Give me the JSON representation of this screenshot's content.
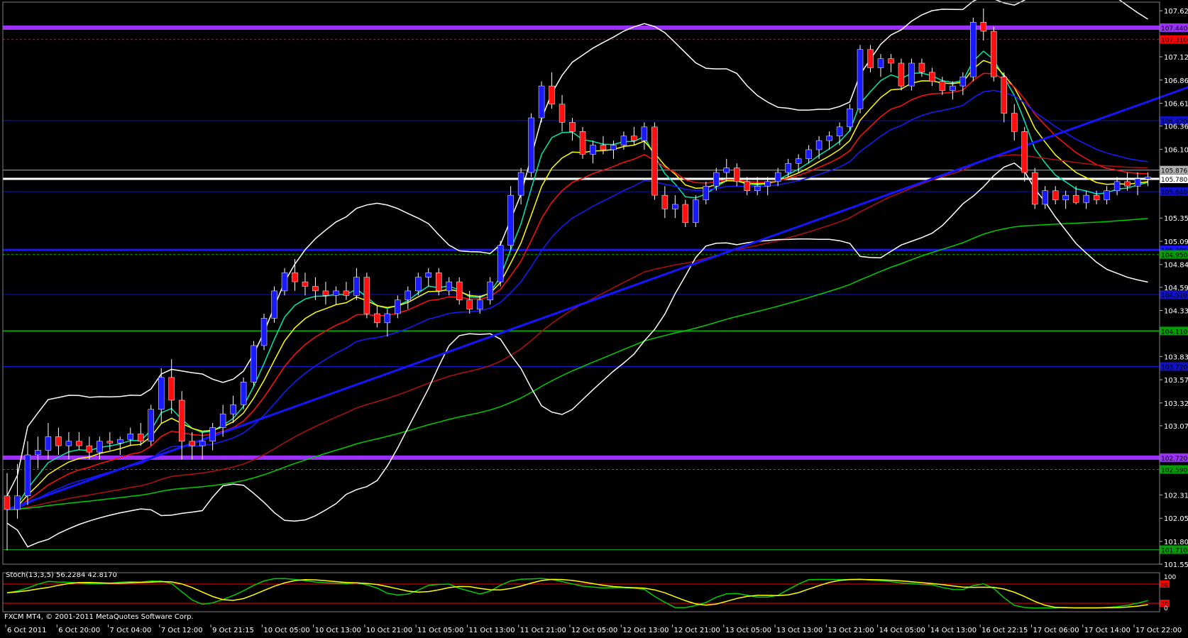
{
  "chart_data": {
    "type": "candlestick",
    "instrument_info": "",
    "footer": "FXCM MT4, © 2001-2011 MetaQuotes Software Corp.",
    "price_axis": {
      "ylim": [
        101.55,
        107.72
      ],
      "ticks": [
        "107.625",
        "107.120",
        "106.865",
        "106.610",
        "106.360",
        "106.105",
        "105.350",
        "105.095",
        "104.840",
        "104.590",
        "104.335",
        "103.830",
        "103.575",
        "103.320",
        "103.070",
        "102.310",
        "102.055",
        "101.800",
        "101.550"
      ]
    },
    "x_axis": {
      "labels": [
        "6 Oct 2011",
        "6 Oct 20:00",
        "7 Oct 04:00",
        "7 Oct 12:00",
        "9 Oct 21:15",
        "10 Oct 05:00",
        "10 Oct 13:00",
        "10 Oct 21:00",
        "11 Oct 05:00",
        "11 Oct 13:00",
        "11 Oct 21:00",
        "12 Oct 05:00",
        "12 Oct 13:00",
        "12 Oct 21:00",
        "13 Oct 05:00",
        "13 Oct 13:00",
        "13 Oct 21:00",
        "14 Oct 05:00",
        "14 Oct 13:00",
        "16 Oct 22:15",
        "17 Oct 06:00",
        "17 Oct 14:00",
        "17 Oct 22:00"
      ],
      "bar_count": 112
    },
    "ohlc": [
      [
        102.3,
        102.55,
        101.7,
        102.15
      ],
      [
        102.15,
        102.65,
        102.05,
        102.3
      ],
      [
        102.3,
        102.9,
        102.2,
        102.75
      ],
      [
        102.75,
        102.95,
        102.6,
        102.8
      ],
      [
        102.8,
        103.1,
        102.7,
        102.95
      ],
      [
        102.95,
        103.05,
        102.75,
        102.85
      ],
      [
        102.85,
        103.0,
        102.7,
        102.9
      ],
      [
        102.9,
        103.0,
        102.8,
        102.85
      ],
      [
        102.85,
        102.95,
        102.7,
        102.78
      ],
      [
        102.78,
        102.95,
        102.7,
        102.9
      ],
      [
        102.9,
        103.0,
        102.8,
        102.88
      ],
      [
        102.88,
        102.95,
        102.75,
        102.92
      ],
      [
        102.92,
        103.05,
        102.85,
        102.98
      ],
      [
        102.98,
        103.1,
        102.85,
        102.9
      ],
      [
        102.9,
        103.3,
        102.85,
        103.25
      ],
      [
        103.25,
        103.7,
        103.1,
        103.6
      ],
      [
        103.6,
        103.8,
        103.2,
        103.35
      ],
      [
        103.35,
        103.45,
        102.7,
        102.9
      ],
      [
        102.9,
        103.0,
        102.7,
        102.85
      ],
      [
        102.85,
        103.0,
        102.7,
        102.9
      ],
      [
        102.9,
        103.1,
        102.8,
        103.05
      ],
      [
        103.05,
        103.3,
        102.95,
        103.2
      ],
      [
        103.2,
        103.4,
        103.1,
        103.3
      ],
      [
        103.3,
        103.6,
        103.25,
        103.55
      ],
      [
        103.55,
        104.0,
        103.5,
        103.95
      ],
      [
        103.95,
        104.3,
        103.9,
        104.25
      ],
      [
        104.25,
        104.6,
        104.2,
        104.55
      ],
      [
        104.55,
        104.8,
        104.5,
        104.75
      ],
      [
        104.75,
        104.9,
        104.55,
        104.65
      ],
      [
        104.65,
        104.75,
        104.5,
        104.6
      ],
      [
        104.6,
        104.7,
        104.45,
        104.55
      ],
      [
        104.55,
        104.65,
        104.4,
        104.5
      ],
      [
        104.5,
        104.6,
        104.4,
        104.55
      ],
      [
        104.55,
        104.65,
        104.45,
        104.5
      ],
      [
        104.5,
        104.8,
        104.45,
        104.7
      ],
      [
        104.7,
        104.75,
        104.25,
        104.3
      ],
      [
        104.3,
        104.4,
        104.15,
        104.2
      ],
      [
        104.2,
        104.35,
        104.05,
        104.3
      ],
      [
        104.3,
        104.5,
        104.25,
        104.45
      ],
      [
        104.45,
        104.6,
        104.35,
        104.55
      ],
      [
        104.55,
        104.75,
        104.5,
        104.7
      ],
      [
        104.7,
        104.8,
        104.6,
        104.75
      ],
      [
        104.75,
        104.8,
        104.5,
        104.55
      ],
      [
        104.55,
        104.7,
        104.5,
        104.65
      ],
      [
        104.65,
        104.7,
        104.4,
        104.45
      ],
      [
        104.45,
        104.55,
        104.3,
        104.35
      ],
      [
        104.35,
        104.5,
        104.3,
        104.45
      ],
      [
        104.45,
        104.7,
        104.4,
        104.65
      ],
      [
        104.65,
        105.1,
        104.6,
        105.05
      ],
      [
        105.05,
        105.7,
        105.0,
        105.6
      ],
      [
        105.6,
        105.9,
        105.5,
        105.85
      ],
      [
        105.85,
        106.5,
        105.8,
        106.45
      ],
      [
        106.45,
        106.85,
        106.4,
        106.8
      ],
      [
        106.8,
        106.95,
        106.55,
        106.6
      ],
      [
        106.6,
        106.7,
        106.3,
        106.4
      ],
      [
        106.4,
        106.45,
        106.2,
        106.3
      ],
      [
        106.3,
        106.35,
        106.0,
        106.05
      ],
      [
        106.05,
        106.2,
        105.95,
        106.15
      ],
      [
        106.15,
        106.25,
        106.05,
        106.1
      ],
      [
        106.1,
        106.2,
        106.0,
        106.15
      ],
      [
        106.15,
        106.3,
        106.1,
        106.25
      ],
      [
        106.25,
        106.35,
        106.15,
        106.2
      ],
      [
        106.2,
        106.4,
        106.1,
        106.35
      ],
      [
        106.35,
        106.4,
        105.55,
        105.6
      ],
      [
        105.6,
        105.7,
        105.35,
        105.45
      ],
      [
        105.45,
        105.6,
        105.35,
        105.5
      ],
      [
        105.5,
        105.55,
        105.25,
        105.3
      ],
      [
        105.3,
        105.6,
        105.25,
        105.55
      ],
      [
        105.55,
        105.75,
        105.5,
        105.7
      ],
      [
        105.7,
        105.9,
        105.65,
        105.85
      ],
      [
        105.85,
        106.0,
        105.75,
        105.9
      ],
      [
        105.9,
        105.95,
        105.7,
        105.75
      ],
      [
        105.75,
        105.8,
        105.6,
        105.65
      ],
      [
        105.65,
        105.8,
        105.6,
        105.7
      ],
      [
        105.7,
        105.8,
        105.6,
        105.75
      ],
      [
        105.75,
        105.9,
        105.7,
        105.85
      ],
      [
        105.85,
        106.0,
        105.8,
        105.95
      ],
      [
        105.95,
        106.05,
        105.85,
        106.0
      ],
      [
        106.0,
        106.15,
        105.95,
        106.1
      ],
      [
        106.1,
        106.25,
        106.0,
        106.2
      ],
      [
        106.2,
        106.3,
        106.1,
        106.25
      ],
      [
        106.25,
        106.4,
        106.15,
        106.35
      ],
      [
        106.35,
        106.6,
        106.3,
        106.55
      ],
      [
        106.55,
        107.25,
        106.5,
        107.2
      ],
      [
        107.2,
        107.25,
        106.95,
        107.0
      ],
      [
        107.0,
        107.15,
        106.9,
        107.1
      ],
      [
        107.1,
        107.15,
        106.95,
        107.05
      ],
      [
        107.05,
        107.1,
        106.75,
        106.8
      ],
      [
        106.8,
        107.1,
        106.75,
        107.05
      ],
      [
        107.05,
        107.1,
        106.9,
        106.95
      ],
      [
        106.95,
        107.0,
        106.8,
        106.85
      ],
      [
        106.85,
        106.9,
        106.7,
        106.75
      ],
      [
        106.75,
        106.85,
        106.65,
        106.8
      ],
      [
        106.8,
        106.95,
        106.7,
        106.9
      ],
      [
        106.9,
        107.55,
        106.85,
        107.5
      ],
      [
        107.5,
        107.65,
        107.3,
        107.4
      ],
      [
        107.4,
        107.45,
        106.85,
        106.9
      ],
      [
        106.9,
        106.95,
        106.4,
        106.5
      ],
      [
        106.5,
        106.6,
        106.2,
        106.3
      ],
      [
        106.3,
        106.35,
        105.75,
        105.85
      ],
      [
        105.85,
        105.9,
        105.45,
        105.5
      ],
      [
        105.5,
        105.7,
        105.45,
        105.65
      ],
      [
        105.65,
        105.7,
        105.5,
        105.55
      ],
      [
        105.55,
        105.65,
        105.45,
        105.6
      ],
      [
        105.6,
        105.7,
        105.5,
        105.52
      ],
      [
        105.52,
        105.65,
        105.45,
        105.6
      ],
      [
        105.6,
        105.65,
        105.5,
        105.55
      ],
      [
        105.55,
        105.7,
        105.5,
        105.65
      ],
      [
        105.65,
        105.8,
        105.6,
        105.75
      ],
      [
        105.75,
        105.85,
        105.65,
        105.7
      ],
      [
        105.7,
        105.85,
        105.6,
        105.78
      ],
      [
        105.78,
        105.85,
        105.7,
        105.8
      ]
    ],
    "horizontal_lines": [
      {
        "price": 107.44,
        "color": "#9b30ff",
        "width": 6,
        "style": "solid",
        "label": "107.440"
      },
      {
        "price": 107.31,
        "color": "#ff0000",
        "width": 1,
        "style": "dashed",
        "label": "107.310"
      },
      {
        "price": 106.42,
        "color": "#1010c8",
        "width": 1,
        "style": "solid",
        "label": "106.420"
      },
      {
        "price": 105.876,
        "color": "#b0b0b0",
        "width": 1,
        "style": "solid",
        "label": "105.876"
      },
      {
        "price": 105.78,
        "color": "#ffffff",
        "width": 3,
        "style": "solid",
        "label": "105.780"
      },
      {
        "price": 105.64,
        "color": "#1010c8",
        "width": 1,
        "style": "solid",
        "label": "105.640"
      },
      {
        "price": 105.0,
        "color": "#1515ff",
        "width": 3,
        "style": "solid",
        "label": "105.000"
      },
      {
        "price": 104.95,
        "color": "#00a000",
        "width": 1,
        "style": "dashed",
        "label": "104.950"
      },
      {
        "price": 104.51,
        "color": "#1010c8",
        "width": 1,
        "style": "solid",
        "label": "104.510"
      },
      {
        "price": 104.11,
        "color": "#00a000",
        "width": 2,
        "style": "solid",
        "label": "104.110"
      },
      {
        "price": 103.72,
        "color": "#1010c8",
        "width": 1,
        "style": "solid",
        "label": "103.720"
      },
      {
        "price": 102.72,
        "color": "#9b30ff",
        "width": 6,
        "style": "solid",
        "label": "102.720"
      },
      {
        "price": 102.59,
        "color": "#00a000",
        "width": 1,
        "style": "dashed",
        "label": "102.590"
      },
      {
        "price": 101.71,
        "color": "#00a000",
        "width": 1,
        "style": "solid",
        "label": "101.710"
      }
    ],
    "trendline": {
      "from": [
        0,
        102.15
      ],
      "to": [
        119,
        106.95
      ],
      "color": "#1515ff",
      "width": 3
    },
    "indicators": [
      {
        "name": "EMA 5",
        "color": "#00e8b0",
        "period": 5
      },
      {
        "name": "EMA 8",
        "color": "#ffff00",
        "period": 8
      },
      {
        "name": "EMA 13",
        "color": "#ff1010",
        "period": 13
      },
      {
        "name": "EMA 21",
        "color": "#1a1aff",
        "period": 21
      },
      {
        "name": "EMA 55",
        "color": "#b01010",
        "period": 55
      },
      {
        "name": "EMA 100",
        "color": "#00cc00",
        "period": 100
      },
      {
        "name": "Bollinger Bands 20, 2",
        "color": "#ffffff"
      }
    ],
    "stochastic": {
      "label": "Stoch(13,3,5) 56.2284 42.8170",
      "k_color": "#00cc00",
      "d_color": "#ffff00",
      "levels": [
        {
          "value": 80,
          "label": "80",
          "color": "#ff0000"
        },
        {
          "value": 20,
          "label": "20",
          "color": "#ff0000"
        }
      ],
      "axis_labels": [
        "100",
        "0"
      ]
    }
  }
}
